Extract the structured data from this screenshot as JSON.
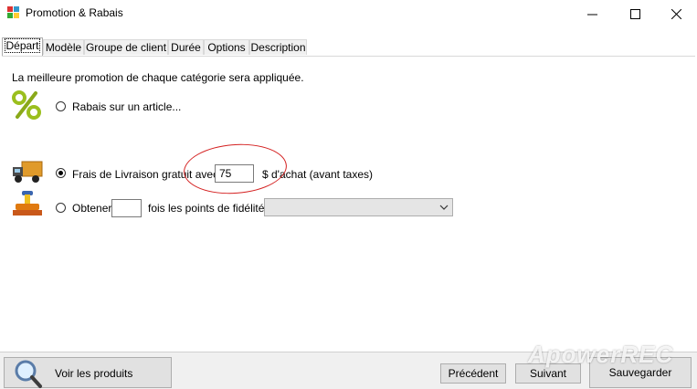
{
  "window": {
    "title": "Promotion & Rabais",
    "minimize_glyph": "—",
    "maximize_glyph": "☐",
    "close_glyph": "✕"
  },
  "tabs": [
    {
      "label": "Départ",
      "active": true
    },
    {
      "label": "Modèle"
    },
    {
      "label": "Groupe de client"
    },
    {
      "label": "Durée"
    },
    {
      "label": "Options"
    },
    {
      "label": "Description"
    }
  ],
  "main": {
    "info_text": "La meilleure promotion de chaque catégorie sera appliquée.",
    "option_discount": {
      "label": "Rabais sur un article...",
      "checked": false
    },
    "option_shipping": {
      "label_before": "Frais de Livraison gratuit avec",
      "amount": "75",
      "label_after": "$ d'achat (avant taxes)",
      "checked": true
    },
    "option_points": {
      "label_before": "Obtener",
      "value": "",
      "label_after": "fois les points de fidélités",
      "select_value": "",
      "checked": false
    }
  },
  "footer": {
    "view_products": "Voir les produits",
    "previous": "Précédent",
    "next": "Suivant",
    "save": "Sauvegarder"
  },
  "watermark": "ApowerREC",
  "colors": {
    "annotation": "#d42020",
    "percent_icon": "#9bbf1e",
    "truck": "#d98a1a"
  }
}
